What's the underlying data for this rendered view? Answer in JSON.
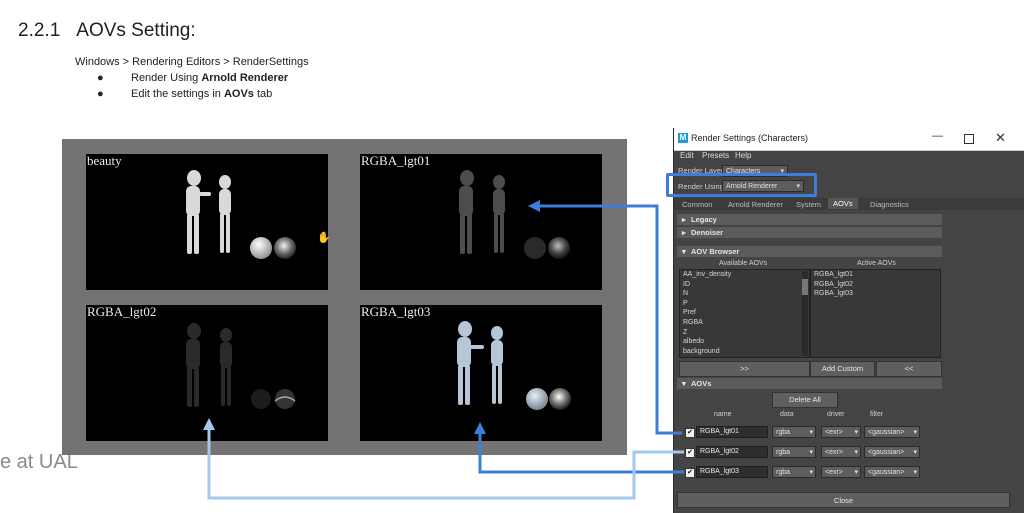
{
  "doc": {
    "heading_num": "2.2.1",
    "heading": "AOVs Setting:",
    "path_text": "Windows > Rendering Editors > RenderSettings",
    "bullet1_pre": "Render Using ",
    "bullet1_bold": "Arnold Renderer",
    "bullet2_pre": "Edit the settings in ",
    "bullet2_bold": "AOVs",
    "bullet2_post": " tab",
    "bullet_dot": "●",
    "footer_fragment": "e at UAL"
  },
  "renders": {
    "beauty": "beauty",
    "lgt01": "RGBA_lgt01",
    "lgt02": "RGBA_lgt02",
    "lgt03": "RGBA_lgt03"
  },
  "window": {
    "title": "Render Settings (Characters)",
    "menu": [
      "Edit",
      "Presets",
      "Help"
    ],
    "render_layer_label": "Render Layer",
    "render_layer_value": "Characters",
    "render_using_label": "Render Using",
    "render_using_value": "Arnold Renderer",
    "tabs": [
      "Common",
      "Arnold Renderer",
      "System",
      "AOVs",
      "Diagnostics"
    ],
    "sections": {
      "legacy": "Legacy",
      "denoiser": "Denoiser",
      "aov_browser": "AOV Browser",
      "aovs": "AOVs"
    },
    "available_label": "Available AOVs",
    "active_label": "Active AOVs",
    "available": [
      "AA_inv_density",
      "ID",
      "N",
      "P",
      "Pref",
      "RGBA",
      "Z",
      "albedo",
      "background"
    ],
    "active": [
      "RGBA_lgt01",
      "RGBA_lgt02",
      "RGBA_lgt03"
    ],
    "btn_add": ">>",
    "btn_custom": "Add Custom",
    "btn_remove": "<<",
    "btn_delete_all": "Delete All",
    "col_name": "name",
    "col_data": "data",
    "col_driver": "driver",
    "col_filter": "filter",
    "rows": [
      {
        "name": "RGBA_lgt01",
        "data": "rgba",
        "driver": "<exr>",
        "filter": "<gaussian>"
      },
      {
        "name": "RGBA_lgt02",
        "data": "rgba",
        "driver": "<exr>",
        "filter": "<gaussian>"
      },
      {
        "name": "RGBA_lgt03",
        "data": "rgba",
        "driver": "<exr>",
        "filter": "<gaussian>"
      }
    ],
    "close": "Close"
  },
  "colors": {
    "arrow_dark": "#3d7fd8",
    "arrow_light": "#a6c7ee",
    "window_bg": "#444444"
  }
}
